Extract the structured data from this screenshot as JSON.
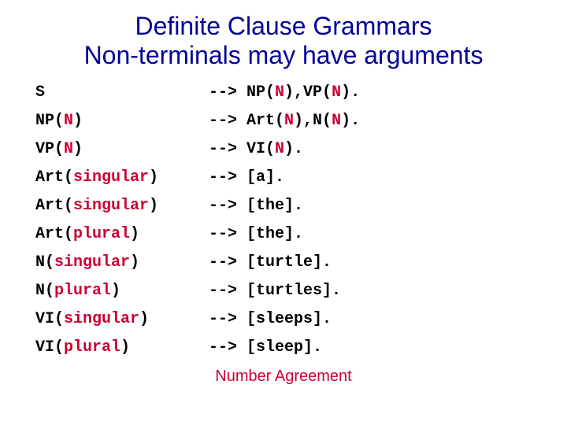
{
  "title_line1": "Definite Clause Grammars",
  "title_line2": "Non-terminals may have arguments",
  "footer": "Number Agreement",
  "arrow": "-->",
  "rules": [
    {
      "lhs_pre": "S",
      "lhs_red": "",
      "lhs_post": "",
      "rhs_a": " NP(",
      "rhs_b": "N",
      "rhs_c": "),VP(",
      "rhs_d": "N",
      "rhs_e": ")."
    },
    {
      "lhs_pre": "NP(",
      "lhs_red": "N",
      "lhs_post": ")",
      "rhs_a": " Art(",
      "rhs_b": "N",
      "rhs_c": "),N(",
      "rhs_d": "N",
      "rhs_e": ")."
    },
    {
      "lhs_pre": "VP(",
      "lhs_red": "N",
      "lhs_post": ")",
      "rhs_a": " VI(",
      "rhs_b": "N",
      "rhs_c": ").",
      "rhs_d": "",
      "rhs_e": ""
    },
    {
      "lhs_pre": "Art(",
      "lhs_red": "singular",
      "lhs_post": ")",
      "rhs_a": " [a].",
      "rhs_b": "",
      "rhs_c": "",
      "rhs_d": "",
      "rhs_e": ""
    },
    {
      "lhs_pre": "Art(",
      "lhs_red": "singular",
      "lhs_post": ")",
      "rhs_a": " [the].",
      "rhs_b": "",
      "rhs_c": "",
      "rhs_d": "",
      "rhs_e": ""
    },
    {
      "lhs_pre": "Art(",
      "lhs_red": "plural",
      "lhs_post": ")",
      "rhs_a": " [the].",
      "rhs_b": "",
      "rhs_c": "",
      "rhs_d": "",
      "rhs_e": ""
    },
    {
      "lhs_pre": "N(",
      "lhs_red": "singular",
      "lhs_post": ")",
      "rhs_a": " [turtle].",
      "rhs_b": "",
      "rhs_c": "",
      "rhs_d": "",
      "rhs_e": ""
    },
    {
      "lhs_pre": "N(",
      "lhs_red": "plural",
      "lhs_post": ")",
      "rhs_a": " [turtles].",
      "rhs_b": "",
      "rhs_c": "",
      "rhs_d": "",
      "rhs_e": ""
    },
    {
      "lhs_pre": "VI(",
      "lhs_red": "singular",
      "lhs_post": ")",
      "rhs_a": " [sleeps].",
      "rhs_b": "",
      "rhs_c": "",
      "rhs_d": "",
      "rhs_e": ""
    },
    {
      "lhs_pre": "VI(",
      "lhs_red": "plural",
      "lhs_post": ")",
      "rhs_a": " [sleep].",
      "rhs_b": "",
      "rhs_c": "",
      "rhs_d": "",
      "rhs_e": ""
    }
  ]
}
